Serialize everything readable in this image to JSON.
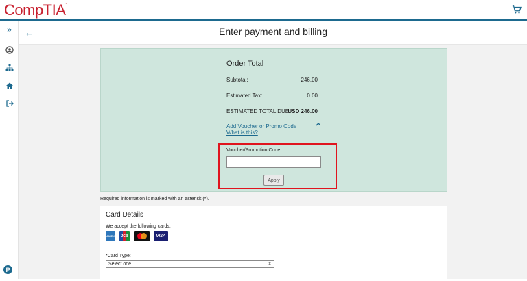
{
  "brand": {
    "logo_text": "CompTIA",
    "logo_mark": "."
  },
  "header": {
    "title": "Enter payment and billing"
  },
  "sidebar": {
    "items": [
      {
        "icon": "expand-icon",
        "glyph": "»"
      },
      {
        "icon": "user-icon",
        "glyph": "●"
      },
      {
        "icon": "sitemap-icon",
        "glyph": "⊞"
      },
      {
        "icon": "home-icon",
        "glyph": "⌂"
      },
      {
        "icon": "logout-icon",
        "glyph": "⇥"
      }
    ]
  },
  "order": {
    "heading": "Order Total",
    "subtotal_label": "Subtotal:",
    "subtotal_value": "246.00",
    "tax_label": "Estimated Tax:",
    "tax_value": "0.00",
    "total_label": "ESTIMATED TOTAL DUE:",
    "total_value": "USD 246.00",
    "promo_link": "Add Voucher or Promo Code",
    "what_link": "What is this?",
    "voucher_label": "Voucher/Promotion Code:",
    "voucher_value": "",
    "apply_label": "Apply"
  },
  "required_note": "Required information is marked with an asterisk (*).",
  "card": {
    "heading": "Card Details",
    "accept_text": "We accept the following cards:",
    "brands": [
      "AMEX",
      "JCB",
      "MC",
      "VISA"
    ],
    "card_type_label": "*Card Type:",
    "card_type_selected": "Select one..."
  },
  "colors": {
    "brand_red": "#c8202f",
    "accent": "#1d6a8f",
    "highlight": "#e0141e",
    "panel": "#cfe6dd"
  }
}
